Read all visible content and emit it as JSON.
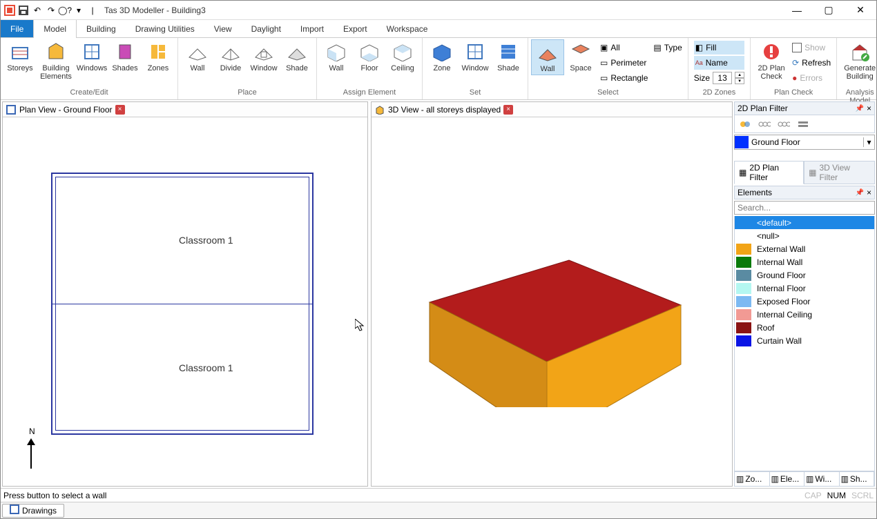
{
  "title": "Tas 3D Modeller - Building3",
  "menu": {
    "file": "File",
    "tabs": [
      "Model",
      "Building",
      "Drawing Utilities",
      "View",
      "Daylight",
      "Import",
      "Export",
      "Workspace"
    ],
    "active_index": 0
  },
  "ribbon": {
    "groups": {
      "create_edit": {
        "label": "Create/Edit",
        "items": [
          "Storeys",
          "Building Elements",
          "Windows",
          "Shades",
          "Zones"
        ]
      },
      "place": {
        "label": "Place",
        "items": [
          "Wall",
          "Divide",
          "Window",
          "Shade"
        ]
      },
      "assign": {
        "label": "Assign Element",
        "items": [
          "Wall",
          "Floor",
          "Ceiling"
        ]
      },
      "set": {
        "label": "Set",
        "items": [
          "Zone",
          "Window",
          "Shade"
        ]
      },
      "select": {
        "label": "Select",
        "items": [
          "Wall",
          "Space"
        ],
        "opts": {
          "all": "All",
          "perimeter": "Perimeter",
          "rectangle": "Rectangle",
          "type": "Type"
        }
      },
      "zones2d": {
        "label": "2D Zones",
        "fill": "Fill",
        "name": "Name",
        "size_label": "Size",
        "size_value": "13"
      },
      "plancheck": {
        "label": "Plan Check",
        "big": "2D Plan Check",
        "show": "Show",
        "refresh": "Refresh",
        "errors": "Errors"
      },
      "analysis": {
        "label": "Analysis Model",
        "big": "Generate Building"
      }
    }
  },
  "panes": {
    "plan_title": "Plan View - Ground Floor",
    "view3d_title": "3D View - all storeys displayed",
    "room_label_1": "Classroom 1",
    "room_label_2": "Classroom 1",
    "north": "N"
  },
  "filter_panel": {
    "title": "2D Plan Filter",
    "floor": "Ground Floor",
    "tab1": "2D Plan Filter",
    "tab2": "3D View Filter"
  },
  "elements_panel": {
    "title": "Elements",
    "search_placeholder": "Search...",
    "items": [
      {
        "name": "<default>",
        "color": null,
        "selected": true
      },
      {
        "name": "<null>",
        "color": null,
        "selected": false
      },
      {
        "name": "External Wall",
        "color": "#F2A417",
        "selected": false
      },
      {
        "name": "Internal Wall",
        "color": "#0A7A0A",
        "selected": false
      },
      {
        "name": "Ground Floor",
        "color": "#5A8BA2",
        "selected": false
      },
      {
        "name": "Internal Floor",
        "color": "#B4F7F1",
        "selected": false
      },
      {
        "name": "Exposed Floor",
        "color": "#7CB9F2",
        "selected": false
      },
      {
        "name": "Internal Ceiling",
        "color": "#F29A94",
        "selected": false
      },
      {
        "name": "Roof",
        "color": "#8A1313",
        "selected": false
      },
      {
        "name": "Curtain Wall",
        "color": "#0A14E5",
        "selected": false
      }
    ],
    "mini_tabs": [
      "Zo...",
      "Ele...",
      "Wi...",
      "Sh..."
    ],
    "mini_active": 1
  },
  "status": {
    "message": "Press button to select a wall",
    "indicators": [
      "CAP",
      "NUM",
      "SCRL"
    ],
    "active_ind": 1
  },
  "bottom_tab": "Drawings"
}
